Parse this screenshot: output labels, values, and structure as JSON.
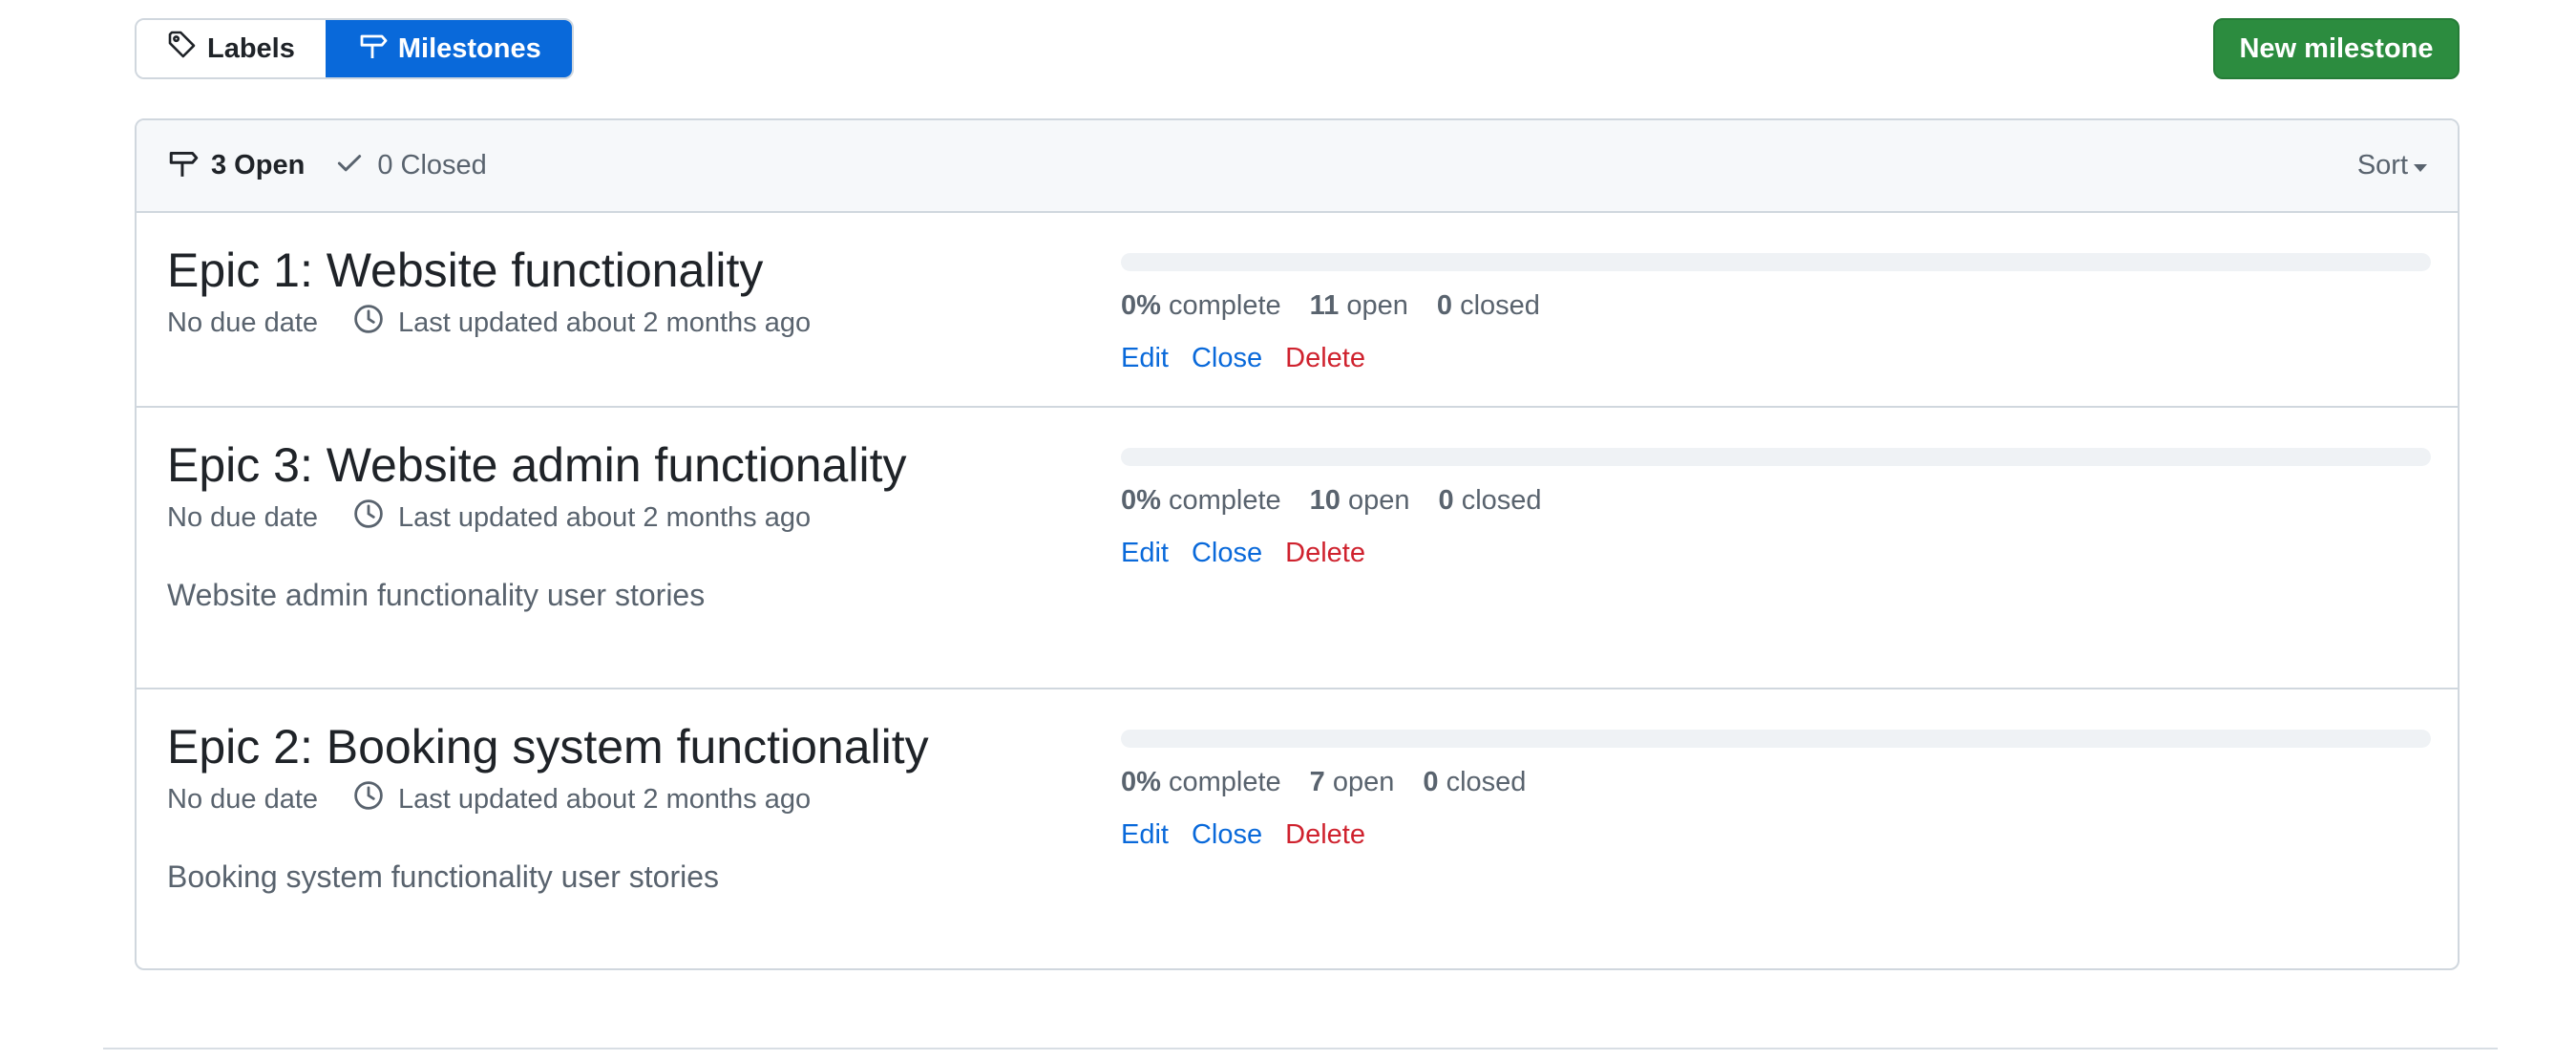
{
  "subnav": {
    "labels_label": "Labels",
    "milestones_label": "Milestones"
  },
  "new_milestone_label": "New milestone",
  "header": {
    "open_label": "3 Open",
    "closed_label": "0 Closed",
    "sort_label": "Sort"
  },
  "milestones": [
    {
      "title": "Epic 1: Website functionality",
      "due": "No due date",
      "updated": "Last updated about 2 months ago",
      "description": "",
      "percent": "0%",
      "percent_label": "complete",
      "open_count": "11",
      "open_label": "open",
      "closed_count": "0",
      "closed_label": "closed",
      "progress_fraction": 0,
      "edit_label": "Edit",
      "close_label": "Close",
      "delete_label": "Delete"
    },
    {
      "title": "Epic 3: Website admin functionality",
      "due": "No due date",
      "updated": "Last updated about 2 months ago",
      "description": "Website admin functionality user stories",
      "percent": "0%",
      "percent_label": "complete",
      "open_count": "10",
      "open_label": "open",
      "closed_count": "0",
      "closed_label": "closed",
      "progress_fraction": 0,
      "edit_label": "Edit",
      "close_label": "Close",
      "delete_label": "Delete"
    },
    {
      "title": "Epic 2: Booking system functionality",
      "due": "No due date",
      "updated": "Last updated about 2 months ago",
      "description": "Booking system functionality user stories",
      "percent": "0%",
      "percent_label": "complete",
      "open_count": "7",
      "open_label": "open",
      "closed_count": "0",
      "closed_label": "closed",
      "progress_fraction": 0,
      "edit_label": "Edit",
      "close_label": "Close",
      "delete_label": "Delete"
    }
  ],
  "icons": {
    "labels": "tag-icon",
    "milestones": "milestone-icon",
    "open": "milestone-icon",
    "closed": "check-icon",
    "updated": "clock-icon",
    "sort": "caret-down-icon"
  },
  "colors": {
    "accent": "#0969da",
    "primary_button": "#2c8c3f",
    "danger": "#cf222e",
    "muted": "#59636e"
  }
}
